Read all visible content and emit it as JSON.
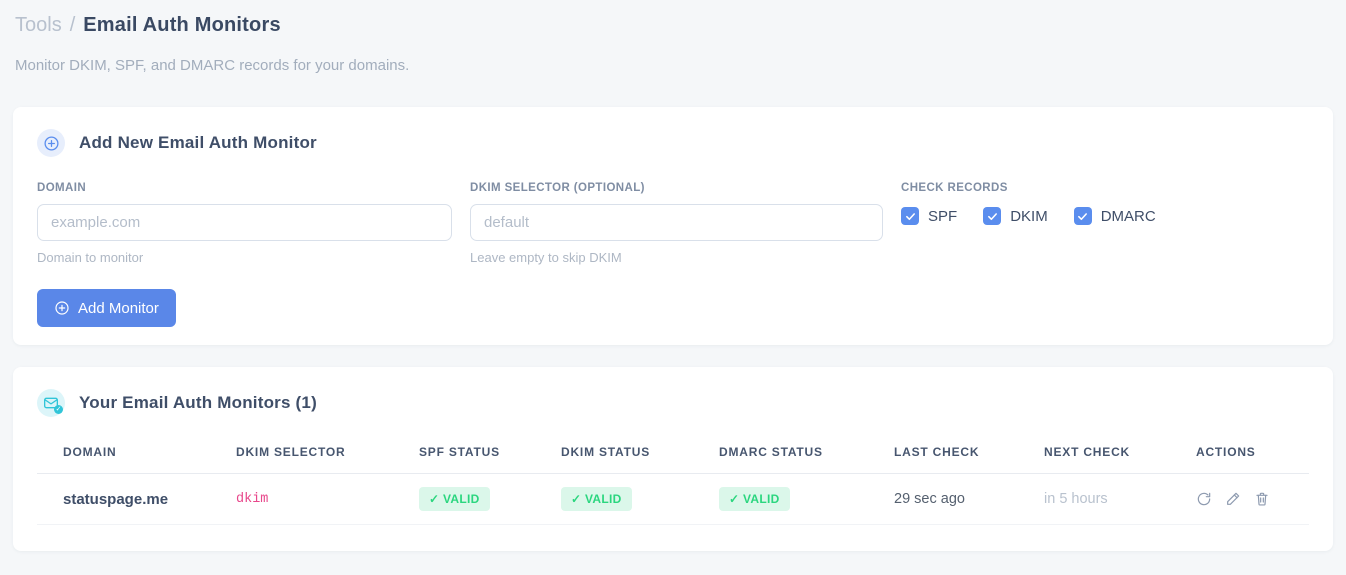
{
  "colors": {
    "accent_blue": "#5a8dee",
    "button_blue": "#5a87e8",
    "accent_cyan": "#31c5d8",
    "success_green": "#2bd67f",
    "success_bg": "#dbf7ea",
    "code_pink": "#e8478b"
  },
  "breadcrumb": {
    "section": "Tools",
    "separator": "/",
    "page": "Email Auth Monitors"
  },
  "subtitle": "Monitor DKIM, SPF, and DMARC records for your domains.",
  "add_card": {
    "icon": "plus-circle-icon",
    "title": "Add New Email Auth Monitor",
    "domain_field": {
      "label": "DOMAIN",
      "placeholder": "example.com",
      "helper": "Domain to monitor"
    },
    "dkim_field": {
      "label": "DKIM SELECTOR (OPTIONAL)",
      "placeholder": "default",
      "helper": "Leave empty to skip DKIM"
    },
    "check_records": {
      "label": "CHECK RECORDS",
      "options": [
        {
          "label": "SPF",
          "checked": true
        },
        {
          "label": "DKIM",
          "checked": true
        },
        {
          "label": "DMARC",
          "checked": true
        }
      ]
    },
    "submit_label": "Add Monitor"
  },
  "monitors_card": {
    "icon": "envelope-check-icon",
    "title": "Your Email Auth Monitors (1)",
    "table": {
      "headers": [
        "DOMAIN",
        "DKIM SELECTOR",
        "SPF STATUS",
        "DKIM STATUS",
        "DMARC STATUS",
        "LAST CHECK",
        "NEXT CHECK",
        "ACTIONS"
      ],
      "rows": [
        {
          "domain": "statuspage.me",
          "dkim_selector": "dkim",
          "spf_status": "✓ VALID",
          "dkim_status": "✓ VALID",
          "dmarc_status": "✓ VALID",
          "last_check": "29 sec ago",
          "next_check": "in 5 hours",
          "actions": [
            "refresh-icon",
            "edit-icon",
            "delete-icon"
          ]
        }
      ]
    }
  }
}
